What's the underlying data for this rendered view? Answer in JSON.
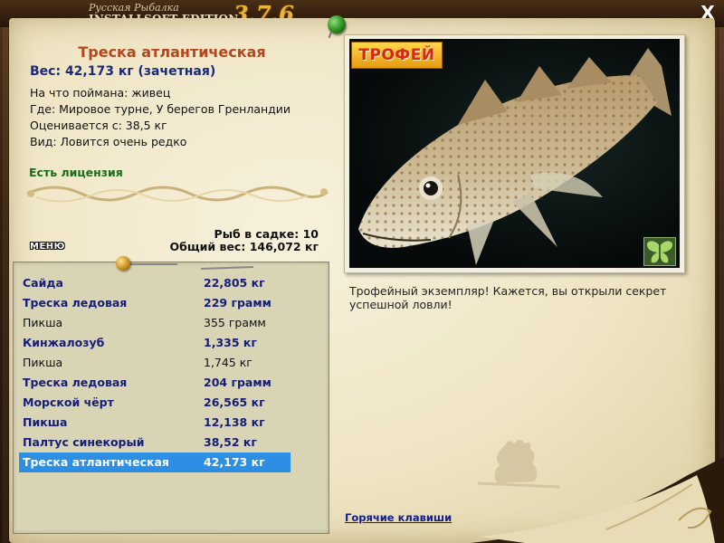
{
  "app": {
    "brand_top": "Русская Рыбалка",
    "brand_bottom": "INSTALLSOFT EDITION",
    "version": "3.7.6",
    "close_label": "X"
  },
  "catch": {
    "title": "Треска атлантическая",
    "weight": "Вес: 42,173 кг (зачетная)",
    "bait": "На что поймана: живец",
    "location": "Где: Мировое турне, У берегов Гренландии",
    "valued_from": "Оценивается с: 38,5 кг",
    "rarity": "Вид: Ловится очень редко",
    "license": "Есть лицензия"
  },
  "cage": {
    "count": "Рыб в садке: 10",
    "total": "Общий вес: 146,072 кг"
  },
  "menu_label": "МЕНЮ",
  "catch_list": [
    {
      "name": "Сайда",
      "weight": "22,805 кг",
      "bold": true
    },
    {
      "name": "Треска ледовая",
      "weight": "229 грамм",
      "bold": true
    },
    {
      "name": "Пикша",
      "weight": "355 грамм",
      "bold": false
    },
    {
      "name": "Кинжалозуб",
      "weight": "1,335 кг",
      "bold": true
    },
    {
      "name": "Пикша",
      "weight": "1,745 кг",
      "bold": false
    },
    {
      "name": "Треска ледовая",
      "weight": "204 грамм",
      "bold": true
    },
    {
      "name": "Морской чёрт",
      "weight": "26,565 кг",
      "bold": true
    },
    {
      "name": "Пикша",
      "weight": "12,138 кг",
      "bold": true
    },
    {
      "name": "Палтус синекорый",
      "weight": "38,52 кг",
      "bold": true
    },
    {
      "name": "Треска атлантическая",
      "weight": "42,173 кг",
      "bold": true,
      "selected": true
    }
  ],
  "trophy_label": "ТРОФЕЙ",
  "description": "Трофейный экземпляр! Кажется, вы открыли секрет успешной ловли!",
  "hotkeys_label": "Горячие клавиши",
  "colors": {
    "title": "#b5461b",
    "weight": "#1a2a7a",
    "license": "#1a6b1a",
    "selection": "#2d8fe4",
    "trophy_bg": "#f5b824"
  },
  "icons": {
    "pin": "green-pushpin-icon",
    "butterfly": "butterfly-icon",
    "close": "close-icon"
  }
}
